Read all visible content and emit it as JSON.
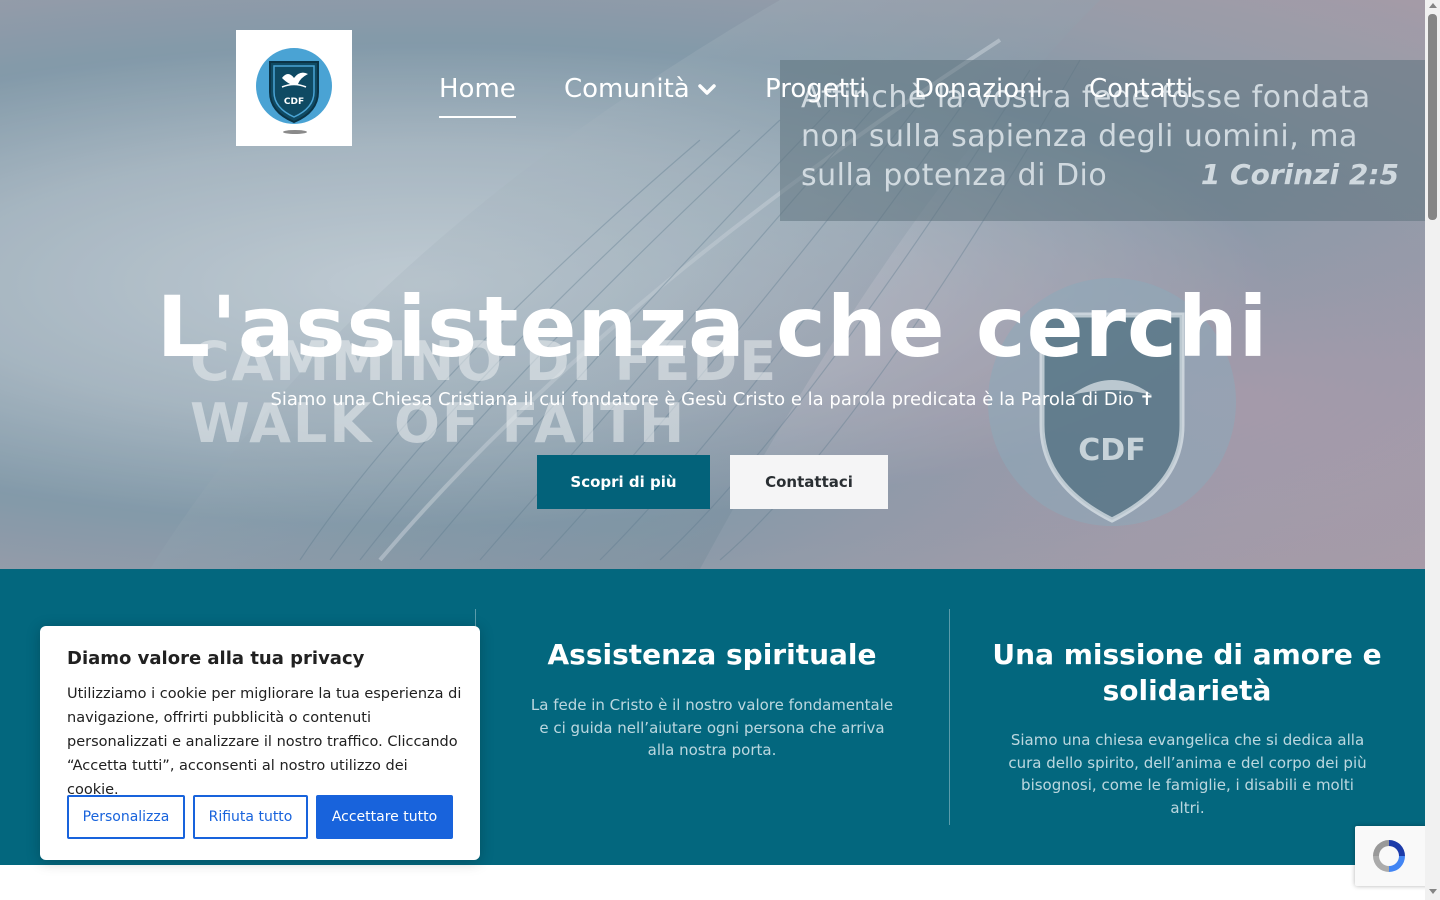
{
  "nav": {
    "items": [
      {
        "label": "Home",
        "active": true
      },
      {
        "label": "Comunità",
        "has_dropdown": true,
        "icon": "chevron-down-icon"
      },
      {
        "label": "Progetti"
      },
      {
        "label": "Donazioni"
      },
      {
        "label": "Contatti"
      }
    ]
  },
  "logo": {
    "text": "CDF",
    "icon": "church-dove-shield-logo"
  },
  "hero_image": {
    "verse_lines": [
      "Affinchè la vostra fede fosse fondata",
      "non sulla sapienza degli uomini, ma",
      "sulla potenza di Dio"
    ],
    "verse_ref": "1 Corinzi 2:5",
    "bg_text_line1": "CAMMINO DI FEDE",
    "bg_text_line2": "WALK OF FAITH",
    "bg_shield_text": "CDF"
  },
  "hero": {
    "title": "L'assistenza che cerchi",
    "subtitle": "Siamo una Chiesa Cristiana il cui fondatore è Gesù Cristo e la parola predicata è la Parola di Dio ✝",
    "primary_button": "Scopri di più",
    "secondary_button": "Contattaci"
  },
  "features": [
    {
      "title": "Assistenza spirituale",
      "text": "La fede in Cristo è il nostro valore fondamentale e ci guida nell’aiutare ogni persona che arriva alla nostra porta."
    },
    {
      "title": "Una missione di amore e solidarietà",
      "text": "Siamo una chiesa evangelica che si dedica alla cura dello spirito, dell’anima e del corpo dei più bisognosi, come le famiglie, i disabili e molti altri."
    }
  ],
  "cookie": {
    "title": "Diamo valore alla tua privacy",
    "text": "Utilizziamo i cookie per migliorare la tua esperienza di navigazione, offrirti pubblicità o contenuti personalizzati e analizzare il nostro traffico. Cliccando “Accetta tutti”, acconsenti al nostro utilizzo dei cookie.",
    "customize_button": "Personalizza",
    "reject_button": "Rifiuta tutto",
    "accept_button": "Accettare tutto"
  },
  "colors": {
    "primary": "#03627a",
    "features_bg": "#03677e",
    "cookie_accent": "#1863dc"
  }
}
